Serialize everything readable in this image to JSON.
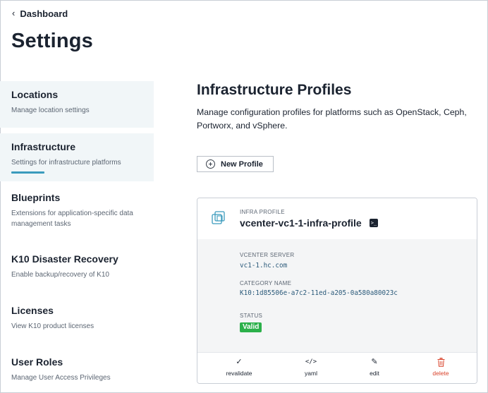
{
  "nav": {
    "back_label": "Dashboard",
    "back_icon": "chevron-left-icon"
  },
  "page": {
    "title": "Settings"
  },
  "sidebar": {
    "items": [
      {
        "title": "Locations",
        "desc": "Manage location settings"
      },
      {
        "title": "Infrastructure",
        "desc": "Settings for infrastructure platforms",
        "active": true
      },
      {
        "title": "Blueprints",
        "desc": "Extensions for application-specific data management tasks"
      },
      {
        "title": "K10 Disaster Recovery",
        "desc": "Enable backup/recovery of K10"
      },
      {
        "title": "Licenses",
        "desc": "View K10 product licenses"
      },
      {
        "title": "User Roles",
        "desc": "Manage User Access Privileges"
      }
    ]
  },
  "main": {
    "title": "Infrastructure Profiles",
    "description": "Manage configuration profiles for platforms such as OpenStack, Ceph, Portworx, and vSphere.",
    "new_button": "New Profile"
  },
  "profile": {
    "kicker": "INFRA PROFILE",
    "name": "vcenter-vc1-1-infra-profile",
    "fields": [
      {
        "label": "VCENTER SERVER",
        "value": "vc1-1.hc.com"
      },
      {
        "label": "CATEGORY NAME",
        "value": "K10:1d85506e-a7c2-11ed-a205-0a580a80023c"
      },
      {
        "label": "STATUS",
        "value": ""
      }
    ],
    "status": "Valid",
    "actions": [
      {
        "label": "revalidate",
        "icon": "check-icon"
      },
      {
        "label": "yaml",
        "icon": "code-icon"
      },
      {
        "label": "edit",
        "icon": "edit-icon"
      },
      {
        "label": "delete",
        "icon": "trash-icon"
      }
    ]
  },
  "colors": {
    "accent": "#3b9bbd",
    "valid": "#2bb04a",
    "delete": "#d9432b",
    "active_bg": "#f1f6f8"
  }
}
